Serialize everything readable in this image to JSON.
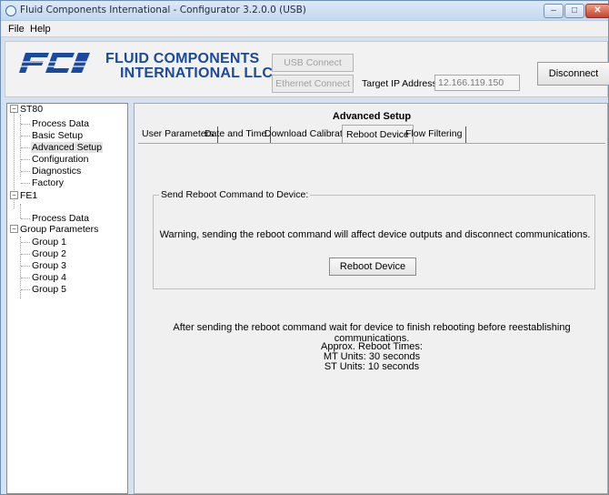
{
  "window": {
    "title": "Fluid Components International - Configurator 3.2.0.0 (USB)",
    "controls": {
      "minimize": "–",
      "maximize": "□",
      "close": "✕"
    }
  },
  "menu": [
    "File",
    "Help"
  ],
  "header": {
    "logo_mark": "FCI",
    "logo_line1": "FLUID COMPONENTS",
    "logo_line2": "INTERNATIONAL LLC",
    "usb_connect": "USB Connect",
    "ethernet_connect": "Ethernet Connect",
    "target_ip_label": "Target IP Address:",
    "target_ip_value": "12.166.119.150",
    "disconnect": "Disconnect"
  },
  "tree": {
    "st80": "ST80",
    "st80_children": [
      "Process Data",
      "Basic Setup",
      "Advanced Setup",
      "Configuration",
      "Diagnostics",
      "Factory"
    ],
    "fe1": "FE1",
    "fe1_children": [
      "Process Data"
    ],
    "group_params": "Group Parameters",
    "group_children": [
      "Group 1",
      "Group 2",
      "Group 3",
      "Group 4",
      "Group 5"
    ],
    "selected": "Advanced Setup"
  },
  "main": {
    "title": "Advanced Setup",
    "tabs": [
      "User Parameters",
      "Date and Time",
      "Download Calibration",
      "Reboot Device",
      "Flow Filtering"
    ],
    "active_tab": "Reboot Device",
    "group_legend": "Send Reboot Command to Device:",
    "warning": "Warning, sending the reboot command will affect device outputs and disconnect communications.",
    "reboot_button": "Reboot Device",
    "after_text": "After sending the reboot command wait for device to finish rebooting before reestablishing communications.",
    "times_heading": "Approx. Reboot Times:",
    "times_mt": "MT Units: 30 seconds",
    "times_st": "ST Units: 10 seconds"
  },
  "colors": {
    "brand_blue": "#1a4aa0",
    "titlebar": "#c4d8ee"
  }
}
